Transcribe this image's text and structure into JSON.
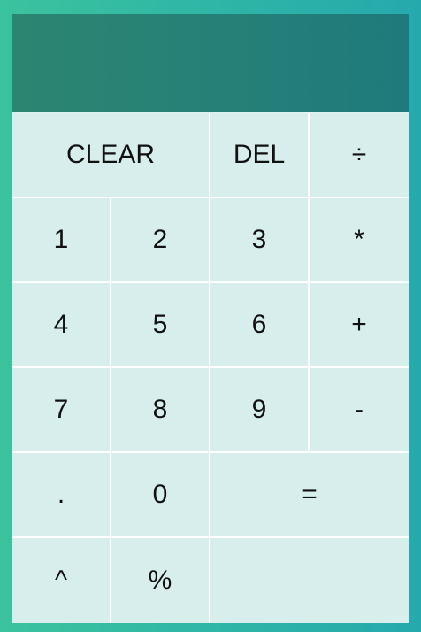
{
  "display": {
    "value": ""
  },
  "buttons": {
    "clear": "CLEAR",
    "del": "DEL",
    "divide": "÷",
    "one": "1",
    "two": "2",
    "three": "3",
    "multiply": "*",
    "four": "4",
    "five": "5",
    "six": "6",
    "add": "+",
    "seven": "7",
    "eight": "8",
    "nine": "9",
    "subtract": "-",
    "decimal": ".",
    "zero": "0",
    "equals": "=",
    "power": "^",
    "percent": "%"
  },
  "colors": {
    "background_gradient_start": "#3bc39e",
    "background_gradient_end": "#26a9ad",
    "display_gradient_start": "#2c8570",
    "display_gradient_end": "#1e7a7c",
    "button_background": "#d7eeec",
    "button_border": "#ffffff",
    "button_text": "#111111"
  }
}
